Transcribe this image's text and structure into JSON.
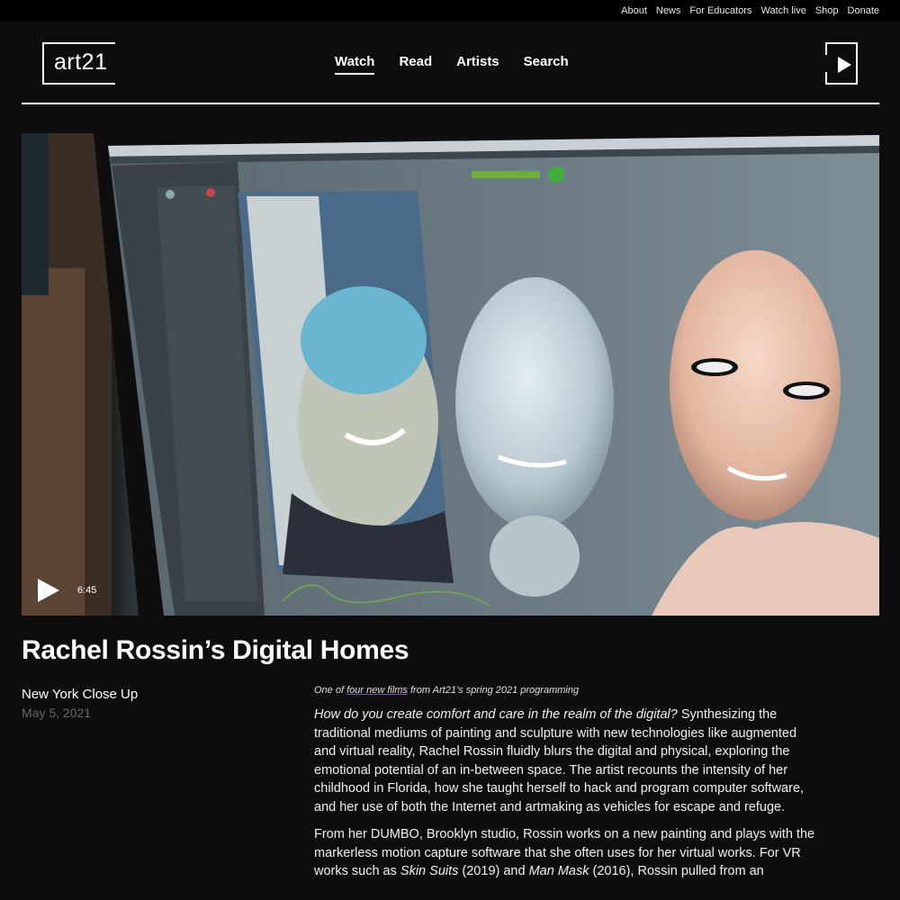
{
  "utility_nav": [
    "About",
    "News",
    "For Educators",
    "Watch live",
    "Shop",
    "Donate"
  ],
  "logo": {
    "text": "art21"
  },
  "main_nav": [
    {
      "label": "Watch",
      "active": true
    },
    {
      "label": "Read",
      "active": false
    },
    {
      "label": "Artists",
      "active": false
    },
    {
      "label": "Search",
      "active": false
    }
  ],
  "video": {
    "duration": "6:45"
  },
  "article": {
    "title": "Rachel Rossin’s Digital Homes",
    "series": "New York Close Up",
    "date": "May 5, 2021",
    "kicker_prefix": "One of ",
    "kicker_link": "four new films",
    "kicker_suffix": " from Art21’s spring 2021 programming",
    "p1_italic": "How do you create comfort and care in the realm of the digital?",
    "p1_text": " Synthesizing the traditional mediums of painting and sculpture with new technologies like augmented and virtual reality, Rachel Rossin fluidly blurs the digital and physical, exploring the emotional potential of an in-between space. The artist recounts the intensity of her childhood in Florida, how she taught herself to hack and program computer software, and her use of both the Internet and artmaking as vehicles for escape and refuge.",
    "p2_a": "From her DUMBO, Brooklyn studio, Rossin works on a new painting and plays with the markerless motion capture software that she often uses for her virtual works. For VR works such as ",
    "p2_work1": "Skin Suits",
    "p2_b": " (2019) and ",
    "p2_work2": "Man Mask",
    "p2_c": " (2016), Rossin pulled from an"
  }
}
